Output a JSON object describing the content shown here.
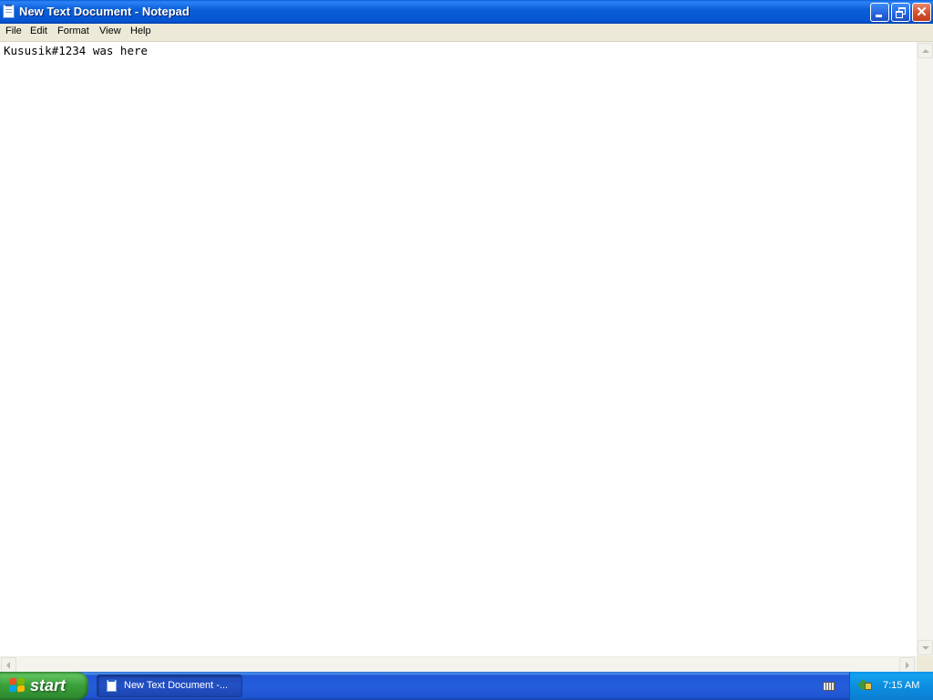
{
  "window": {
    "title": "New Text Document - Notepad"
  },
  "menu": {
    "items": [
      "File",
      "Edit",
      "Format",
      "View",
      "Help"
    ]
  },
  "editor": {
    "content": "Kususik#1234 was here"
  },
  "taskbar": {
    "start_label": "start",
    "task_label": "New Text Document -...",
    "clock": "7:15 AM"
  },
  "colors": {
    "titlebar_blue": "#0a5fd8",
    "close_red": "#d4502d",
    "start_green": "#3a9f3a",
    "taskbar_blue": "#245ddb",
    "tray_blue": "#0d8ee0"
  },
  "icons": {
    "app": "notepad-icon",
    "minimize": "minimize-icon",
    "restore": "restore-icon",
    "close": "close-icon",
    "start": "windows-flag-icon",
    "keyboard": "keyboard-icon",
    "network": "network-icon"
  }
}
